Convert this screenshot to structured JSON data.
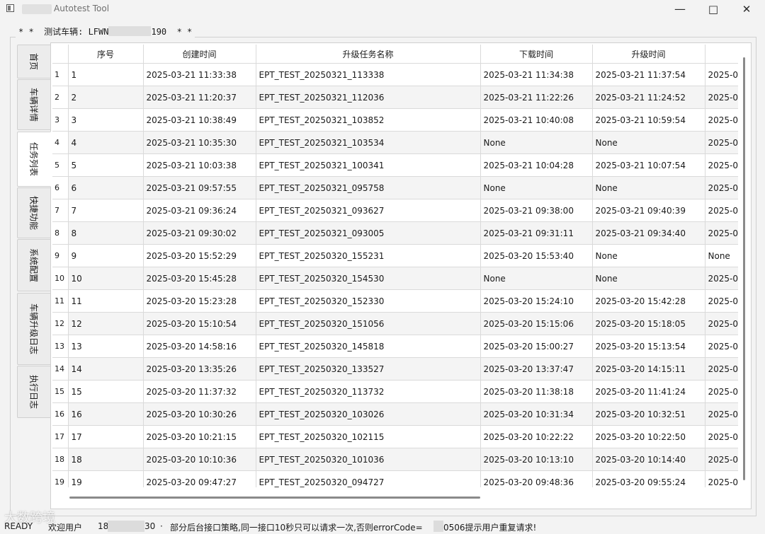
{
  "window": {
    "title": "Autotest Tool"
  },
  "header": {
    "prefix": "* *  测试车辆: LFWN",
    "suffix": "190  * *"
  },
  "tabs": [
    {
      "label": "首页",
      "active": false
    },
    {
      "label": "车辆详情",
      "active": false
    },
    {
      "label": "任务列表",
      "active": true
    },
    {
      "label": "快捷功能",
      "active": false
    },
    {
      "label": "系统配置",
      "active": false
    },
    {
      "label": "车辆升级日志",
      "active": false
    },
    {
      "label": "执行日志",
      "active": false
    }
  ],
  "table": {
    "columns": [
      "序号",
      "创建时间",
      "升级任务名称",
      "下载时间",
      "升级时间",
      ""
    ],
    "rows": [
      [
        "1",
        "1",
        "2025-03-21 11:33:38",
        "EPT_TEST_20250321_113338",
        "2025-03-21 11:34:38",
        "2025-03-21 11:37:54",
        "2025-0"
      ],
      [
        "2",
        "2",
        "2025-03-21 11:20:37",
        "EPT_TEST_20250321_112036",
        "2025-03-21 11:22:26",
        "2025-03-21 11:24:52",
        "2025-0"
      ],
      [
        "3",
        "3",
        "2025-03-21 10:38:49",
        "EPT_TEST_20250321_103852",
        "2025-03-21 10:40:08",
        "2025-03-21 10:59:54",
        "2025-0"
      ],
      [
        "4",
        "4",
        "2025-03-21 10:35:30",
        "EPT_TEST_20250321_103534",
        "None",
        "None",
        "2025-0"
      ],
      [
        "5",
        "5",
        "2025-03-21 10:03:38",
        "EPT_TEST_20250321_100341",
        "2025-03-21 10:04:28",
        "2025-03-21 10:07:54",
        "2025-0"
      ],
      [
        "6",
        "6",
        "2025-03-21 09:57:55",
        "EPT_TEST_20250321_095758",
        "None",
        "None",
        "2025-0"
      ],
      [
        "7",
        "7",
        "2025-03-21 09:36:24",
        "EPT_TEST_20250321_093627",
        "2025-03-21 09:38:00",
        "2025-03-21 09:40:39",
        "2025-0"
      ],
      [
        "8",
        "8",
        "2025-03-21 09:30:02",
        "EPT_TEST_20250321_093005",
        "2025-03-21 09:31:11",
        "2025-03-21 09:34:40",
        "2025-0"
      ],
      [
        "9",
        "9",
        "2025-03-20 15:52:29",
        "EPT_TEST_20250320_155231",
        "2025-03-20 15:53:40",
        "None",
        "None"
      ],
      [
        "10",
        "10",
        "2025-03-20 15:45:28",
        "EPT_TEST_20250320_154530",
        "None",
        "None",
        "2025-0"
      ],
      [
        "11",
        "11",
        "2025-03-20 15:23:28",
        "EPT_TEST_20250320_152330",
        "2025-03-20 15:24:10",
        "2025-03-20 15:42:28",
        "2025-0"
      ],
      [
        "12",
        "12",
        "2025-03-20 15:10:54",
        "EPT_TEST_20250320_151056",
        "2025-03-20 15:15:06",
        "2025-03-20 15:18:05",
        "2025-0"
      ],
      [
        "13",
        "13",
        "2025-03-20 14:58:16",
        "EPT_TEST_20250320_145818",
        "2025-03-20 15:00:27",
        "2025-03-20 15:13:54",
        "2025-0"
      ],
      [
        "14",
        "14",
        "2025-03-20 13:35:26",
        "EPT_TEST_20250320_133527",
        "2025-03-20 13:37:47",
        "2025-03-20 14:15:11",
        "2025-0"
      ],
      [
        "15",
        "15",
        "2025-03-20 11:37:32",
        "EPT_TEST_20250320_113732",
        "2025-03-20 11:38:18",
        "2025-03-20 11:41:24",
        "2025-0"
      ],
      [
        "16",
        "16",
        "2025-03-20 10:30:26",
        "EPT_TEST_20250320_103026",
        "2025-03-20 10:31:34",
        "2025-03-20 10:32:51",
        "2025-0"
      ],
      [
        "17",
        "17",
        "2025-03-20 10:21:15",
        "EPT_TEST_20250320_102115",
        "2025-03-20 10:22:22",
        "2025-03-20 10:22:50",
        "2025-0"
      ],
      [
        "18",
        "18",
        "2025-03-20 10:10:36",
        "EPT_TEST_20250320_101036",
        "2025-03-20 10:13:10",
        "2025-03-20 10:14:40",
        "2025-0"
      ],
      [
        "19",
        "19",
        "2025-03-20 09:47:27",
        "EPT_TEST_20250320_094727",
        "2025-03-20 09:48:36",
        "2025-03-20 09:55:24",
        "2025-0"
      ]
    ]
  },
  "status": {
    "ready": "READY",
    "user_prefix": "欢迎用户",
    "user_mid": "18",
    "user_suffix": "30",
    "separator": "·",
    "message_a": "部分后台接口策略,同一接口10秒只可以请求一次,否则errorCode=",
    "message_b": "0506提示用户重复请求!"
  },
  "watermark": "大数跨境"
}
